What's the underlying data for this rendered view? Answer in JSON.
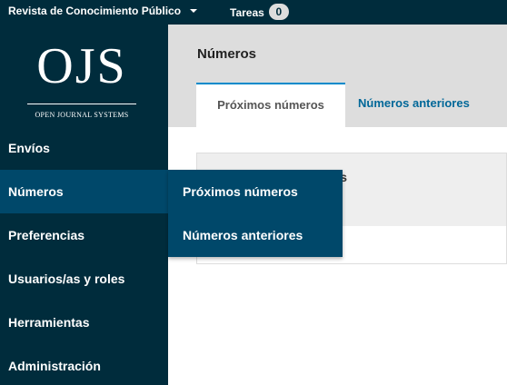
{
  "topbar": {
    "site_title": "Revista de Conocimiento Público",
    "tasks_label": "Tareas",
    "tasks_count": "0"
  },
  "logo": {
    "main": "OJS",
    "subtitle": "OPEN JOURNAL SYSTEMS"
  },
  "sidebar": {
    "items": [
      {
        "label": "Envíos"
      },
      {
        "label": "Números"
      },
      {
        "label": "Preferencias"
      },
      {
        "label": "Usuarios/as y roles"
      },
      {
        "label": "Herramientas"
      },
      {
        "label": "Administración"
      }
    ],
    "active": "Números"
  },
  "flyout": {
    "items": [
      {
        "label": "Próximos números"
      },
      {
        "label": "Números anteriores"
      }
    ]
  },
  "main": {
    "title": "Números",
    "tabs": [
      {
        "label": "Próximos números"
      },
      {
        "label": "Números anteriores"
      }
    ],
    "panel_title_fragment": "s"
  },
  "colors": {
    "sidebar": "#002c3c",
    "active_nav": "#00486a",
    "tab_accent": "#008acb",
    "link": "#006798"
  }
}
